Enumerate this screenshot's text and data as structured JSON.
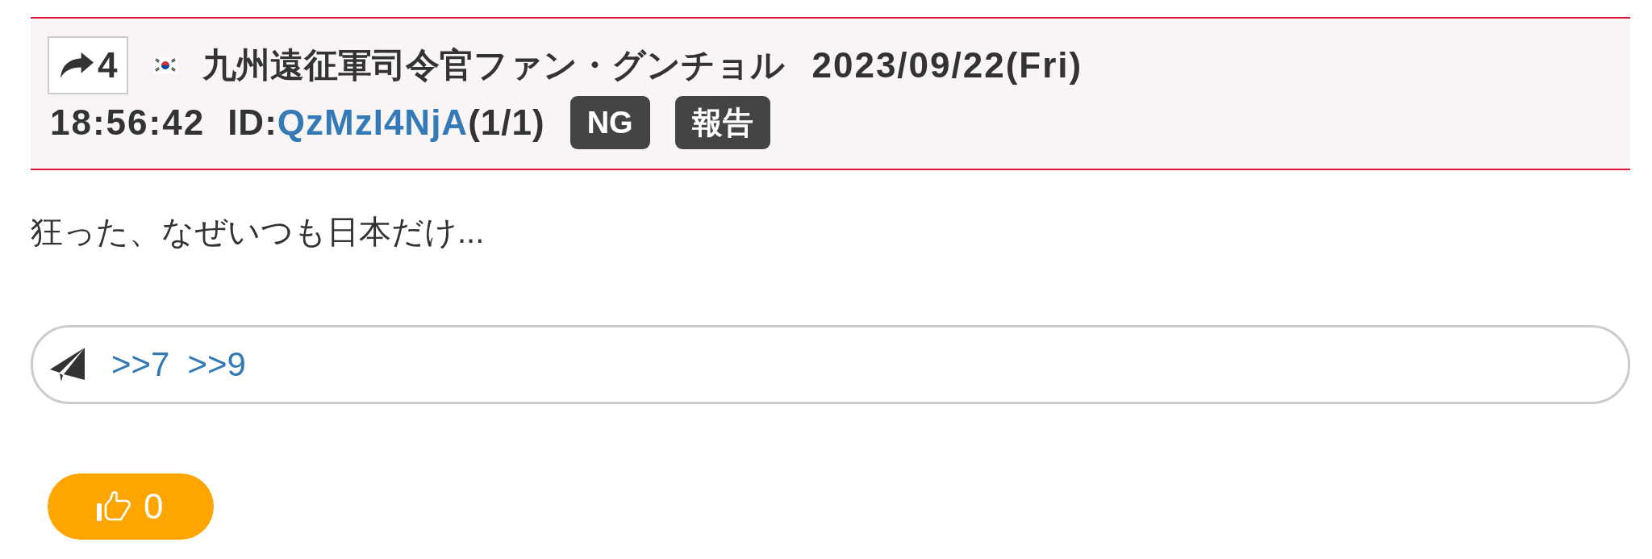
{
  "post": {
    "reply_count": "4",
    "name": "九州遠征軍司令官ファン・グンチョル",
    "date": "2023/09/22(Fri)",
    "time": "18:56:42",
    "id_label": "ID:",
    "id": "QzMzI4NjA",
    "id_count": "(1/1)",
    "actions": [
      {
        "label": "NG"
      },
      {
        "label": "報告"
      }
    ]
  },
  "body": "狂った、なぜいつも日本だけ...",
  "replies": [
    ">>7",
    ">>9"
  ],
  "like": {
    "count": "0"
  }
}
